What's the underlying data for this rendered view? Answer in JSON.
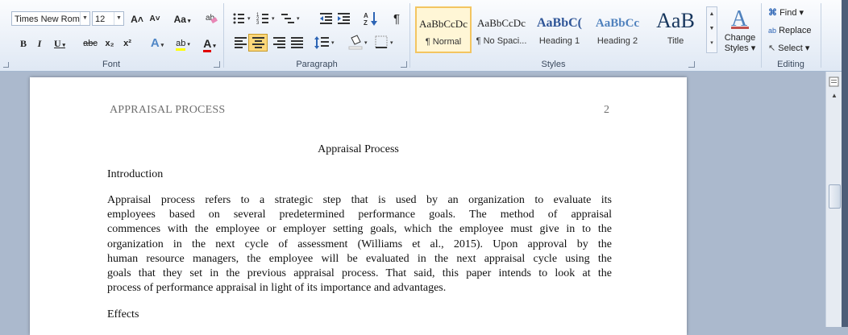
{
  "ribbon": {
    "font": {
      "group_label": "Font",
      "font_name": "Times New Rom",
      "font_size": "12",
      "grow_icon": "A˄",
      "shrink_icon": "A˅",
      "change_case": "Aa",
      "bold": "B",
      "italic": "I",
      "underline": "U",
      "strike": "abc",
      "subscript": "x₂",
      "superscript": "x²",
      "text_effects": "A",
      "highlight": "ab",
      "font_color": "A"
    },
    "paragraph": {
      "group_label": "Paragraph",
      "pilcrow": "¶"
    },
    "styles": {
      "group_label": "Styles",
      "items": [
        {
          "preview": "AaBbCcDc",
          "name": "¶ Normal"
        },
        {
          "preview": "AaBbCcDc",
          "name": "¶ No Spaci..."
        },
        {
          "preview": "AaBbC(",
          "name": "Heading 1"
        },
        {
          "preview": "AaBbCc",
          "name": "Heading 2"
        },
        {
          "preview": "AaB",
          "name": "Title"
        }
      ],
      "change_styles_line1": "Change",
      "change_styles_line2": "Styles ▾"
    },
    "editing": {
      "group_label": "Editing",
      "find": "Find ▾",
      "replace": "Replace",
      "select": "Select ▾"
    }
  },
  "document": {
    "header_left": "APPRAISAL PROCESS",
    "header_right": "2",
    "title": "Appraisal Process",
    "heading_intro": "Introduction",
    "paragraph_lines": [
      "Appraisal process refers to a strategic step that is used by an organization to evaluate its",
      "employees based on several predetermined performance goals. The method of appraisal",
      "commences with the employee or employer setting goals, which the employee must give in to the",
      "organization in the next cycle of assessment (Williams  et al., 2015). Upon approval by the",
      "human resource managers, the employee will be evaluated in the next appraisal  cycle using the",
      "goals that they set in the previous appraisal  process.  That said, this paper intends to look at the",
      "process of performance appraisal  in light  of its importance and advantages."
    ],
    "heading_effects": "Effects"
  },
  "colors": {
    "ribbon_bg": "#dfe8f4",
    "workspace_bg": "#abb9cd",
    "active_align": "#fcd77a",
    "selected_style": "#f3c561"
  }
}
